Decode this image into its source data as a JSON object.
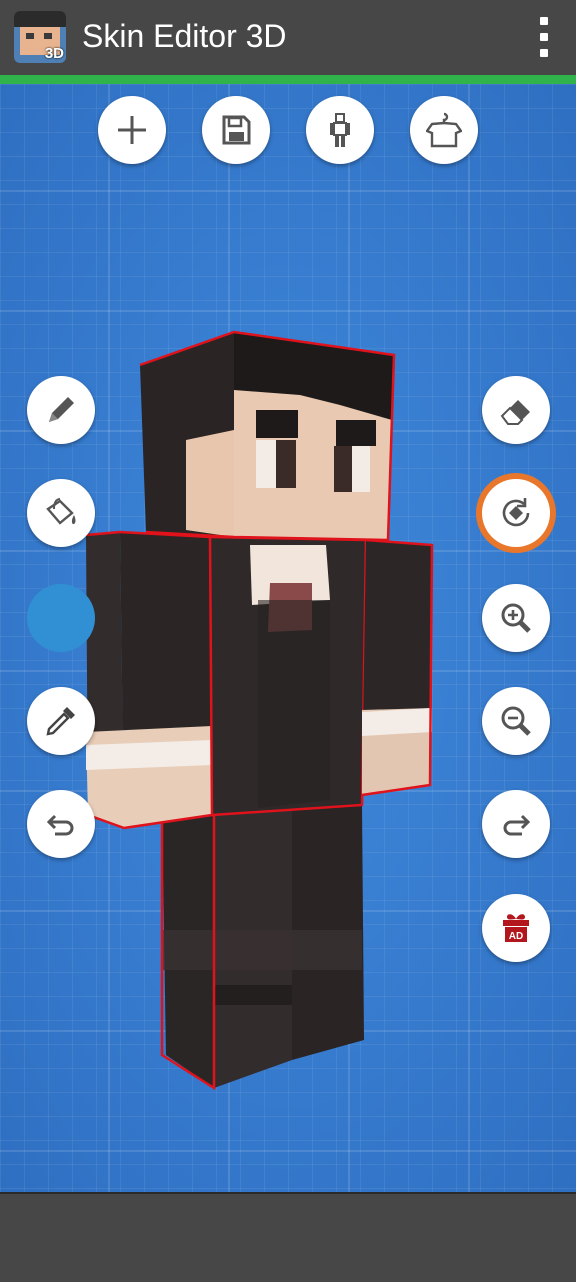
{
  "app": {
    "title": "Skin Editor 3D",
    "logo_badge": "3D",
    "menu_icon": "overflow-menu-icon"
  },
  "top_toolbar": [
    {
      "name": "new-skin-button",
      "icon": "plus-icon"
    },
    {
      "name": "save-button",
      "icon": "floppy-disk-icon"
    },
    {
      "name": "body-model-button",
      "icon": "mannequin-icon"
    },
    {
      "name": "clothing-button",
      "icon": "shirt-hanger-icon"
    }
  ],
  "left_tools": [
    {
      "name": "pencil-tool-button",
      "icon": "pencil-icon"
    },
    {
      "name": "fill-bucket-tool-button",
      "icon": "paint-bucket-icon"
    },
    {
      "name": "current-color-swatch",
      "color": "#3190d4"
    },
    {
      "name": "eyedropper-tool-button",
      "icon": "eyedropper-icon"
    },
    {
      "name": "undo-button",
      "icon": "undo-icon"
    }
  ],
  "right_tools": [
    {
      "name": "eraser-tool-button",
      "icon": "eraser-icon"
    },
    {
      "name": "rotate-view-button",
      "icon": "rotate-icon",
      "active": true
    },
    {
      "name": "zoom-in-button",
      "icon": "zoom-in-icon"
    },
    {
      "name": "zoom-out-button",
      "icon": "zoom-out-icon"
    },
    {
      "name": "redo-button",
      "icon": "redo-icon"
    },
    {
      "name": "watch-ad-gift-button",
      "icon": "gift-ad-icon",
      "label": "AD"
    }
  ],
  "colors": {
    "appbar": "#474747",
    "accent_green": "#2fb34a",
    "canvas_blue": "#3a7fd1",
    "active_ring": "#e8762b",
    "selection_outline": "#e0121b"
  }
}
